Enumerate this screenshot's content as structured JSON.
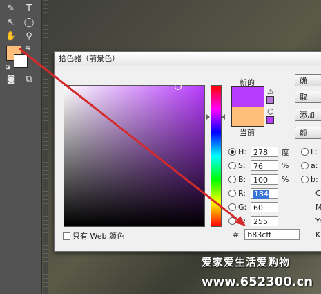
{
  "dialog": {
    "title": "拾色器（前景色）",
    "new_label": "新的",
    "current_label": "当前",
    "only_web_label": "只有 Web 颜色",
    "colors": {
      "new": "#b83cff",
      "current": "#ffbf7a",
      "warn_swatch": "#b878d8",
      "web_swatch": "#bf3cff"
    },
    "fields": {
      "H": {
        "label": "H:",
        "value": "278",
        "unit": "度"
      },
      "S": {
        "label": "S:",
        "value": "76",
        "unit": "%"
      },
      "Bv": {
        "label": "B:",
        "value": "100",
        "unit": "%"
      },
      "R": {
        "label": "R:",
        "value": "184"
      },
      "G": {
        "label": "G:",
        "value": "60"
      },
      "Bc": {
        "label": "B:",
        "value": "255"
      },
      "L": {
        "label": "L:"
      },
      "a": {
        "label": "a:"
      },
      "b": {
        "label": "b:"
      },
      "C": {
        "label": "C:"
      },
      "M": {
        "label": "M:"
      },
      "Y": {
        "label": "Y:"
      },
      "K": {
        "label": "K:"
      }
    },
    "hex_label": "#",
    "hex_value": "b83cff",
    "buttons": {
      "ok": "确",
      "cancel": "取",
      "add": "添加",
      "lib": "颜"
    }
  },
  "toolbar": {
    "foreground_color": "#ffbf7a",
    "background_color": "#ffffff"
  },
  "watermark": {
    "line1": "爱家爱生活爱购物",
    "line2": "www.652300.cn"
  }
}
